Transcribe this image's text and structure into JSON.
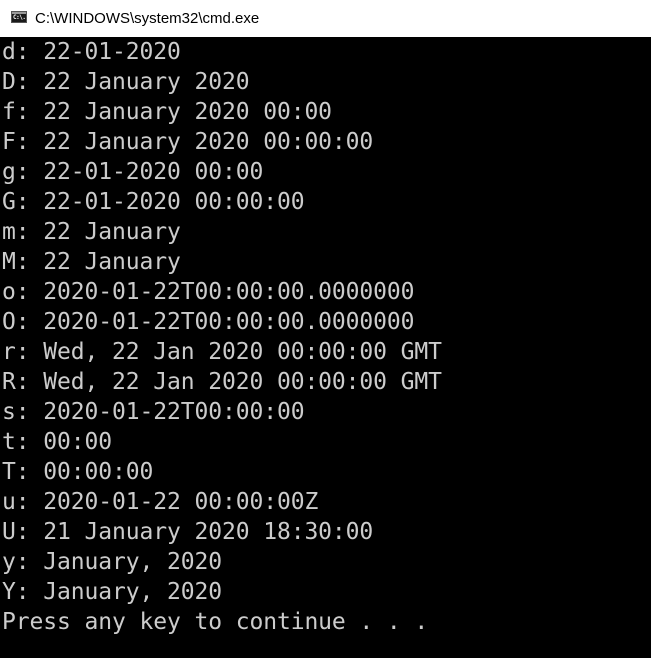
{
  "window": {
    "title": "C:\\WINDOWS\\system32\\cmd.exe",
    "icon": "cmd-icon",
    "icon_text": "C:\\."
  },
  "console": {
    "lines": [
      "d: 22-01-2020",
      "D: 22 January 2020",
      "f: 22 January 2020 00:00",
      "F: 22 January 2020 00:00:00",
      "g: 22-01-2020 00:00",
      "G: 22-01-2020 00:00:00",
      "m: 22 January",
      "M: 22 January",
      "o: 2020-01-22T00:00:00.0000000",
      "O: 2020-01-22T00:00:00.0000000",
      "r: Wed, 22 Jan 2020 00:00:00 GMT",
      "R: Wed, 22 Jan 2020 00:00:00 GMT",
      "s: 2020-01-22T00:00:00",
      "t: 00:00",
      "T: 00:00:00",
      "u: 2020-01-22 00:00:00Z",
      "U: 21 January 2020 18:30:00",
      "y: January, 2020",
      "Y: January, 2020",
      "Press any key to continue . . ."
    ],
    "text_color": "#cccccc",
    "background_color": "#000000"
  }
}
